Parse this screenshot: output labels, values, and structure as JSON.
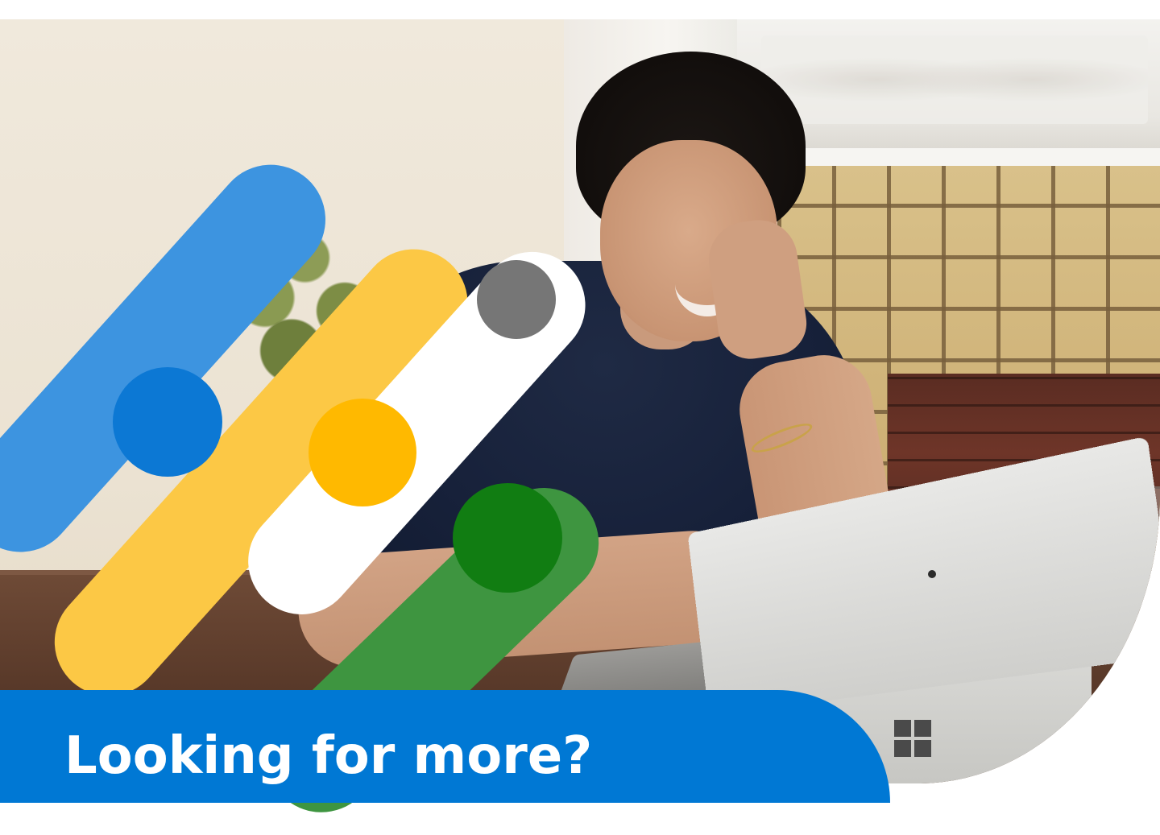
{
  "banner": {
    "headline": "Looking for more?",
    "panel_color": "#0078d4",
    "headline_color": "#ffffff"
  },
  "decor": {
    "stripes": [
      {
        "name": "blue",
        "stripe_color": "#3d94e0",
        "dot_color": "#0c78d4"
      },
      {
        "name": "white",
        "stripe_color": "#ffffff",
        "dot_color": "#767676"
      },
      {
        "name": "yellow",
        "stripe_color": "#fcc845",
        "dot_color": "#ffb900"
      },
      {
        "name": "green",
        "stripe_color": "#3e9540",
        "dot_color": "#117d12"
      }
    ]
  },
  "photo": {
    "icons": [
      "windows-logo-icon"
    ]
  }
}
